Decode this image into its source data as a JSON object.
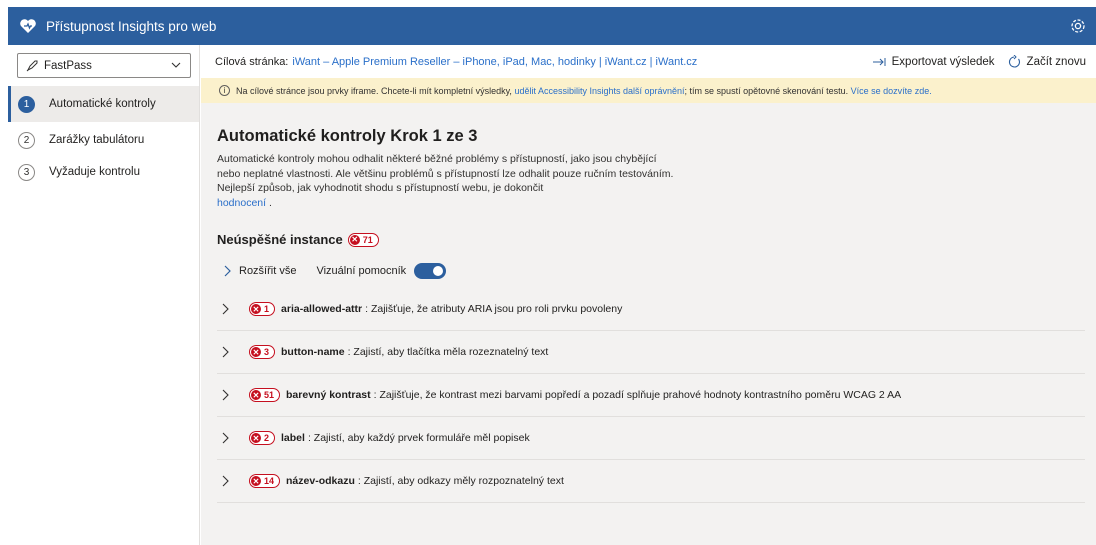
{
  "app": {
    "title": "Přístupnost Insights pro web",
    "accent": "#2c5f9e"
  },
  "sidebar": {
    "select_value": "FastPass",
    "items": [
      {
        "num": "1",
        "label": "Automatické kontroly",
        "active": true
      },
      {
        "num": "2",
        "label": "Zarážky tabulátoru",
        "active": false
      },
      {
        "num": "3",
        "label": "Vyžaduje kontrolu",
        "active": false
      }
    ]
  },
  "topbar": {
    "target_label": "Cílová stránka:",
    "target_link": "iWant – Apple Premium Reseller – iPhone, iPad, Mac, hodinky | iWant.cz | iWant.cz",
    "export_label": "Exportovat výsledek",
    "restart_label": "Začít znovu"
  },
  "banner": {
    "text1": "Na cílové stránce jsou prvky iframe. Chcete-li mít kompletní výsledky,",
    "link1": "udělit Accessibility Insights další oprávnění",
    "text2": "; tím se spustí opětovné skenování testu.",
    "link2": "Více se dozvíte zde."
  },
  "main": {
    "heading": "Automatické kontroly Krok 1 ze 3",
    "description": "Automatické kontroly mohou odhalit některé běžné problémy s přístupností, jako jsou chybějící nebo neplatné vlastnosti. Ale většinu problémů s přístupností lze odhalit pouze ručním testováním. Nejlepší způsob, jak vyhodnotit shodu s přístupností webu, je dokončit",
    "description_link": "hodnocení",
    "description_end": ".",
    "failed_label": "Neúspěšné instance",
    "failed_count": "71",
    "expand_all": "Rozšířit vše",
    "visual_helper": "Vizuální pomocník",
    "rules": [
      {
        "count": "1",
        "name": "aria-allowed-attr",
        "desc": ": Zajišťuje, že atributy ARIA jsou pro roli prvku povoleny"
      },
      {
        "count": "3",
        "name": "button-name",
        "desc": ": Zajistí, aby tlačítka měla rozeznatelný text"
      },
      {
        "count": "51",
        "name": "barevný kontrast",
        "desc": ": Zajišťuje, že kontrast mezi barvami popředí a pozadí splňuje prahové hodnoty kontrastního poměru WCAG 2 AA"
      },
      {
        "count": "2",
        "name": "label",
        "desc": ": Zajistí, aby každý prvek formuláře měl popisek"
      },
      {
        "count": "14",
        "name": "název-odkazu",
        "desc": ": Zajistí, aby odkazy měly rozpoznatelný text"
      }
    ]
  }
}
